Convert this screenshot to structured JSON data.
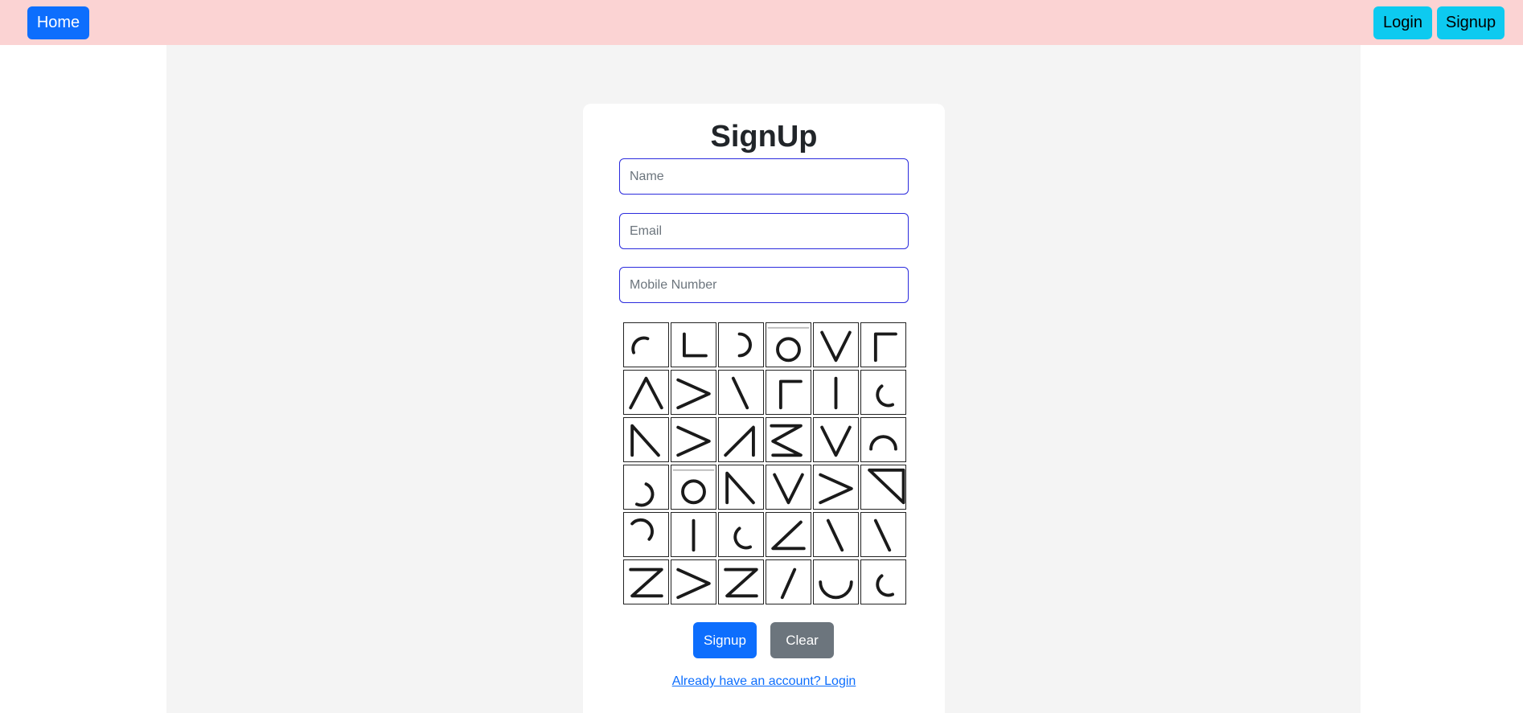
{
  "nav": {
    "home_label": "Home",
    "login_label": "Login",
    "signup_label": "Signup"
  },
  "form": {
    "title": "SignUp",
    "name_placeholder": "Name",
    "email_placeholder": "Email",
    "mobile_placeholder": "Mobile Number",
    "submit_label": "Signup",
    "clear_label": "Clear",
    "login_link": "Already have an account? Login"
  },
  "pattern_grid": {
    "rows": 6,
    "cols": 6,
    "cells": [
      "arc-top-left",
      "corner-bottom-left",
      "arc-right",
      "circle",
      "v-shape",
      "corner-top-left",
      "caret-up",
      "chevron-right",
      "backslash",
      "corner-top-left",
      "vertical-line",
      "arc-bottom-left",
      "n-diagonal",
      "chevron-right",
      "triangle-right",
      "z-reversed",
      "v-shape",
      "arc-top",
      "arc-bottom-right",
      "circle",
      "n-diagonal",
      "v-shape",
      "chevron-right",
      "z-top-diagonal",
      "arc-top-right",
      "vertical-line",
      "arc-bottom-left",
      "angle-left",
      "backslash",
      "backslash",
      "z-shape",
      "chevron-right",
      "z-shape",
      "slash",
      "u-shape",
      "arc-bottom-left"
    ]
  },
  "colors": {
    "navbar": "#fbd3d3",
    "primary": "#0d6efd",
    "info": "#0dcaf0",
    "secondary": "#6c757d",
    "input_border": "#2b2bdd"
  }
}
